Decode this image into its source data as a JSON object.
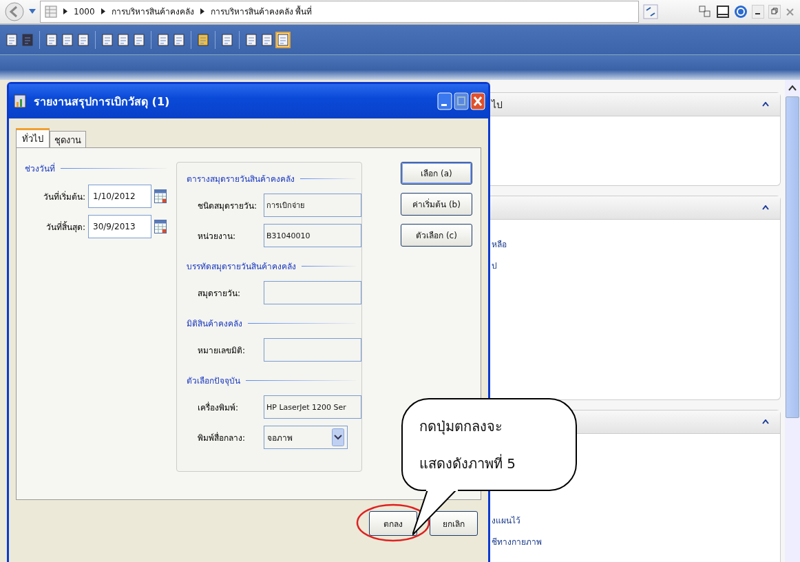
{
  "address_bar": {
    "breadcrumb": [
      "1000",
      "การบริหารสินค้าคงคลัง",
      "การบริหารสินค้าคงคลัง พื้นที่"
    ]
  },
  "background_panels": [
    {
      "title": "ไป"
    },
    {
      "links": [
        "หลือ",
        "ป"
      ]
    },
    {
      "links": [
        "งแผนไว้",
        "ชีทางกายภาพ"
      ]
    }
  ],
  "dialog": {
    "title": "รายงานสรุปการเบิกวัสดุ (1)",
    "tabs": [
      {
        "label": "ทั่วไป",
        "selected": true
      },
      {
        "label": "ชุดงาน",
        "selected": false
      }
    ],
    "date_group": {
      "title": "ช่วงวันที่",
      "fields": [
        {
          "label": "วันที่เริ่มต้น:",
          "value": "1/10/2012"
        },
        {
          "label": "วันที่สิ้นสุด:",
          "value": "30/9/2013"
        }
      ]
    },
    "sections": [
      {
        "title": "ตารางสมุดรายวันสินค้าคงคลัง",
        "fields": [
          {
            "kind": "text",
            "label": "ชนิดสมุดรายวัน:",
            "value": "การเบิกจ่าย"
          },
          {
            "kind": "text",
            "label": "หน่วยงาน:",
            "value": "B31040010"
          }
        ]
      },
      {
        "title": "บรรทัดสมุดรายวันสินค้าคงคลัง",
        "fields": [
          {
            "kind": "text",
            "label": "สมุดรายวัน:"
          }
        ]
      },
      {
        "title": "มิติสินค้าคงคลัง",
        "fields": [
          {
            "kind": "text",
            "label": "หมายเลขมิติ:"
          }
        ]
      },
      {
        "title": "ตัวเลือกปัจจุบัน",
        "fields": [
          {
            "kind": "text",
            "label": "เครื่องพิมพ์:",
            "value": "HP LaserJet 1200 Ser"
          },
          {
            "kind": "select",
            "label": "พิมพ์สื่อกลาง:",
            "value": "จอภาพ"
          }
        ]
      }
    ],
    "side_buttons": [
      {
        "label": "เลือก (a)",
        "default": true
      },
      {
        "label": "ค่าเริ่มต้น (b)",
        "default": false
      },
      {
        "label": "ตัวเลือก (c)",
        "default": false
      }
    ],
    "footer_buttons": [
      {
        "label": "ตกลง",
        "highlighted": true
      },
      {
        "label": "ยกเลิก",
        "highlighted": false
      }
    ]
  },
  "callout": {
    "lines": [
      "กดปุ่มตกลงจะ",
      "แสดงดังภาพที่ 5"
    ]
  }
}
